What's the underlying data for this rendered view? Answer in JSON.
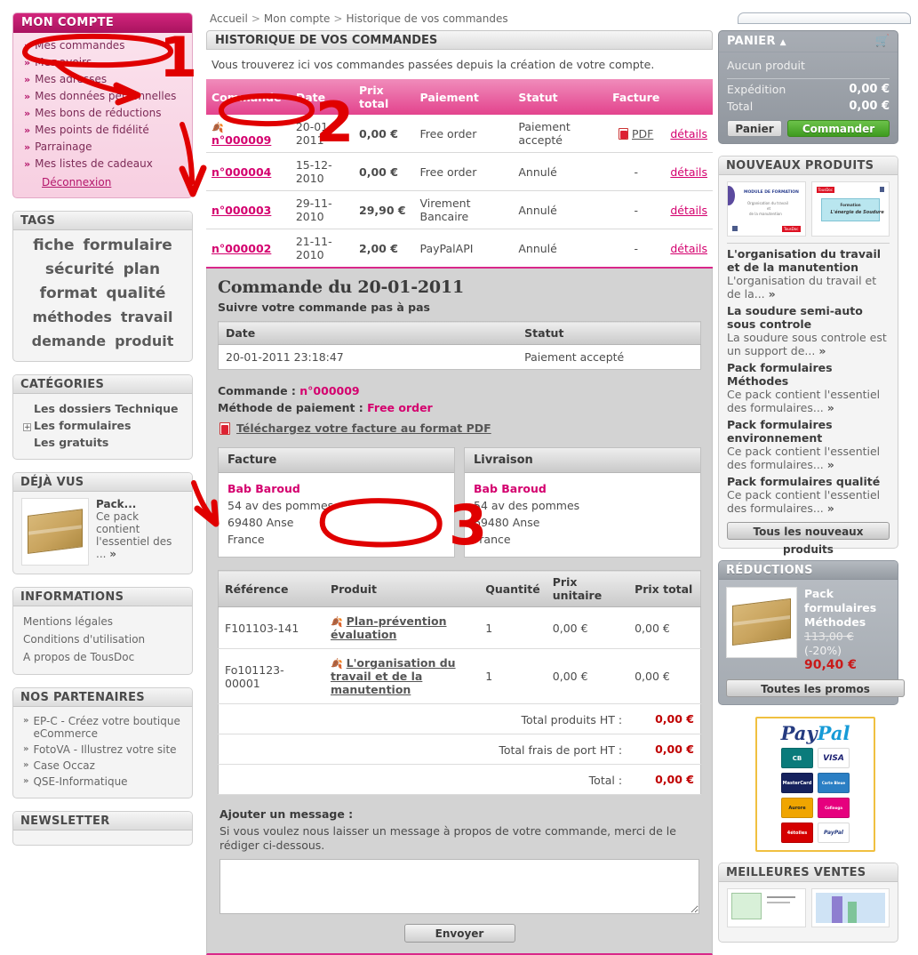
{
  "breadcrumb": {
    "home": "Accueil",
    "account": "Mon compte",
    "current": "Historique de vos commandes",
    "sep": ">"
  },
  "account_block": {
    "title": "MON COMPTE",
    "items": [
      {
        "label": "Mes commandes"
      },
      {
        "label": "Mes avoirs"
      },
      {
        "label": "Mes adresses"
      },
      {
        "label": "Mes données personnelles"
      },
      {
        "label": "Mes bons de réductions"
      },
      {
        "label": "Mes points de fidélité"
      },
      {
        "label": "Parrainage"
      },
      {
        "label": "Mes listes de cadeaux"
      }
    ],
    "logout": "Déconnexion",
    "chevron": "»"
  },
  "tags_block": {
    "title": "TAGS",
    "tags": [
      "fiche",
      "formulaire",
      "sécurité",
      "plan",
      "format",
      "qualité",
      "méthodes",
      "travail",
      "demande",
      "produit"
    ]
  },
  "categories_block": {
    "title": "CATÉGORIES",
    "items": [
      {
        "label": "Les dossiers Technique",
        "expandable": false
      },
      {
        "label": "Les formulaires",
        "expandable": true,
        "plus": "+"
      },
      {
        "label": "Les gratuits",
        "expandable": false
      }
    ]
  },
  "seen_block": {
    "title": "DÉJÀ VUS",
    "product": {
      "name": "Pack...",
      "desc": "Ce pack contient l'essentiel des ...",
      "more": "»"
    }
  },
  "information_block": {
    "title": "INFORMATIONS",
    "items": [
      "Mentions légales",
      "Conditions d'utilisation",
      "A propos de TousDoc"
    ]
  },
  "partners_block": {
    "title": "NOS PARTENAIRES",
    "chevron": "»",
    "items": [
      "EP-C - Créez votre boutique eCommerce",
      "FotoVA - Illustrez votre site",
      "Case Occaz",
      "QSE-Informatique"
    ]
  },
  "newsletter_block": {
    "title": "NEWSLETTER"
  },
  "history": {
    "panel_title": "HISTORIQUE DE VOS COMMANDES",
    "lead": "Vous trouverez ici vos commandes passées depuis la création de votre compte.",
    "columns": [
      "Commande",
      "Date",
      "Prix total",
      "Paiement",
      "Statut",
      "Facture",
      ""
    ],
    "rows": [
      {
        "order": "n°000009",
        "date": "20-01-2011",
        "total": "0,00 €",
        "payment": "Free order",
        "status": "Paiement accepté",
        "invoice": "PDF",
        "has_pdf": true,
        "details": "détails"
      },
      {
        "order": "n°000004",
        "date": "15-12-2010",
        "total": "0,00 €",
        "payment": "Free order",
        "status": "Annulé",
        "invoice": "-",
        "has_pdf": false,
        "details": "détails"
      },
      {
        "order": "n°000003",
        "date": "29-11-2010",
        "total": "29,90 €",
        "payment": "Virement Bancaire",
        "status": "Annulé",
        "invoice": "-",
        "has_pdf": false,
        "details": "détails"
      },
      {
        "order": "n°000002",
        "date": "21-11-2010",
        "total": "2,00 €",
        "payment": "PayPalAPI",
        "status": "Annulé",
        "invoice": "-",
        "has_pdf": false,
        "details": "détails"
      }
    ]
  },
  "order_detail": {
    "title": "Commande du 20-01-2011",
    "subtitle": "Suivre votre commande pas à pas",
    "track_columns": [
      "Date",
      "Statut"
    ],
    "track_rows": [
      {
        "date": "20-01-2011 23:18:47",
        "status": "Paiement accepté"
      }
    ],
    "order_label": "Commande :",
    "order_value": "n°000009",
    "payment_label": "Méthode de paiement :",
    "payment_value": "Free order",
    "invoice_link": "Téléchargez votre facture au format PDF",
    "invoice_box": {
      "title": "Facture",
      "name": "Bab Baroud",
      "lines": [
        "54 av des pommes",
        "69480 Anse",
        "France"
      ]
    },
    "delivery_box": {
      "title": "Livraison",
      "name": "Bab Baroud",
      "lines": [
        "54 av des pommes",
        "69480 Anse",
        "France"
      ]
    },
    "product_columns": [
      "Référence",
      "Produit",
      "Quantité",
      "Prix unitaire",
      "Prix total"
    ],
    "products": [
      {
        "ref": "F101103-141",
        "name": "Plan-prévention évaluation",
        "qty": "1",
        "unit": "0,00 €",
        "total": "0,00 €"
      },
      {
        "ref": "Fo101123-00001",
        "name": "L'organisation du travail et de la manutention",
        "qty": "1",
        "unit": "0,00 €",
        "total": "0,00 €"
      }
    ],
    "totals": [
      {
        "label": "Total produits HT :",
        "value": "0,00 €"
      },
      {
        "label": "Total frais de port HT :",
        "value": "0,00 €"
      },
      {
        "label": "Total :",
        "value": "0,00 €"
      }
    ],
    "message": {
      "title": "Ajouter un message :",
      "help": "Si vous voulez nous laisser un message à propos de votre commande, merci de le rédiger ci-dessous.",
      "value": "",
      "send": "Envoyer"
    }
  },
  "cart": {
    "title": "PANIER",
    "caret": "▲",
    "empty": "Aucun produit",
    "shipping_label": "Expédition",
    "shipping_value": "0,00 €",
    "total_label": "Total",
    "total_value": "0,00 €",
    "cart_button": "Panier",
    "checkout_button": "Commander"
  },
  "new_products": {
    "title": "NOUVEAUX PRODUITS",
    "thumb1": {
      "head": "MODULE DE FORMATION",
      "l1": "Organisation du travail",
      "l2": "et",
      "l3": "de la manutention",
      "brand": "TousDoc"
    },
    "thumb2": {
      "brand": "TousDoc",
      "l1": "Formation",
      "l2": "L'énergie de Soudure"
    },
    "items": [
      {
        "name": "L'organisation du travail et de la manutention",
        "desc": "L'organisation du travail et de la... ",
        "more": "»"
      },
      {
        "name": "La soudure semi-auto sous controle",
        "desc": "La soudure sous controle est un support de... ",
        "more": "»"
      },
      {
        "name": "Pack formulaires Méthodes",
        "desc": "Ce pack contient l'essentiel des formulaires... ",
        "more": "»"
      },
      {
        "name": "Pack formulaires environnement",
        "desc": "Ce pack contient l'essentiel des formulaires... ",
        "more": "»"
      },
      {
        "name": "Pack formulaires qualité",
        "desc": "Ce pack contient l'essentiel des formulaires... ",
        "more": "»"
      }
    ],
    "button": "Tous les nouveaux produits"
  },
  "discounts": {
    "title": "RÉDUCTIONS",
    "product_name": "Pack formulaires Méthodes",
    "old_price": "113,00 €",
    "discount": "(-20%)",
    "new_price": "90,40 €",
    "button": "Toutes les promos"
  },
  "paypal": {
    "logo_pay": "Pay",
    "logo_pal": "Pal",
    "tm": "™",
    "cards": [
      "CB",
      "VISA",
      "MasterCard",
      "Carte Bleue",
      "Aurore",
      "Cofinoga",
      "4étoiles",
      "PayPal"
    ]
  },
  "best_sellers": {
    "title": "MEILLEURES VENTES"
  },
  "annotations": {
    "markers": [
      {
        "num": "1"
      },
      {
        "num": "2"
      },
      {
        "num": "3"
      }
    ],
    "color": "#e00000"
  }
}
